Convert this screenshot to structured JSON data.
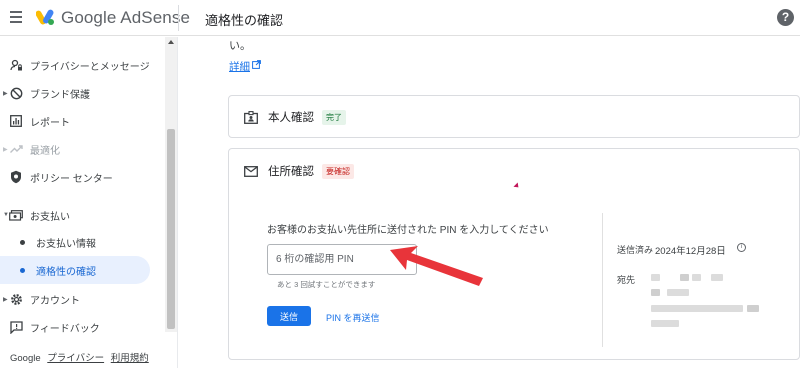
{
  "header": {
    "brand": "Google AdSense",
    "page_title": "適格性の確認",
    "help_icon": "?"
  },
  "sidebar": {
    "items": [
      {
        "label": "プライバシーとメッセージ",
        "icon": "person-lock-icon"
      },
      {
        "label": "ブランド保護",
        "icon": "block-icon"
      },
      {
        "label": "レポート",
        "icon": "bar-chart-icon"
      },
      {
        "label": "最適化",
        "icon": "trending-up-icon"
      },
      {
        "label": "ポリシー センター",
        "icon": "shield-icon"
      },
      {
        "label": "お支払い",
        "icon": "payments-icon"
      },
      {
        "label": "お支払い情報"
      },
      {
        "label": "適格性の確認"
      },
      {
        "label": "アカウント",
        "icon": "gear-icon"
      },
      {
        "label": "フィードバック",
        "icon": "feedback-icon"
      }
    ]
  },
  "footer": {
    "brand": "Google",
    "privacy": "プライバシー",
    "terms": "利用規約"
  },
  "main": {
    "trail_text": "い。",
    "learn_more": "詳細",
    "identity_card": {
      "title": "本人確認",
      "badge": "完了"
    },
    "address_card": {
      "title": "住所確認",
      "badge": "要確認",
      "instruction": "お客様のお支払い先住所に送付された PIN を入力してください",
      "pin_placeholder": "6 桁の確認用 PIN",
      "hint": "あと 3 回試すことができます",
      "send_label": "送信",
      "resend_label": "PIN を再送信",
      "sent_label": "送信済み",
      "sent_date": "2024年12月28日",
      "dest_label": "宛先"
    }
  },
  "colors": {
    "accent": "#1a73e8",
    "active_bg": "#e8f0fe",
    "success_bg": "#e6f4ea",
    "warning_bg": "#fce8e6",
    "annotation_red": "#e8343a"
  }
}
